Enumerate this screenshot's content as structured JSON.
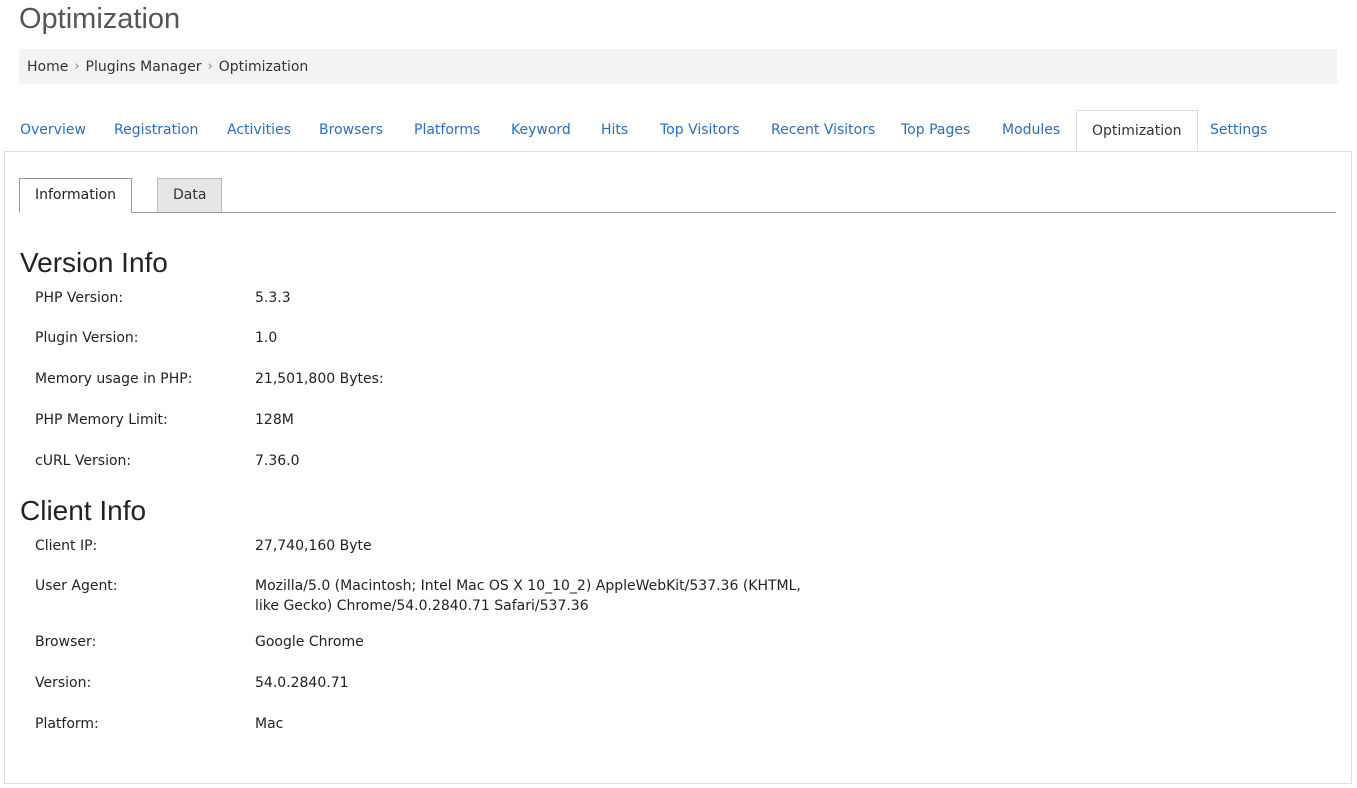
{
  "page": {
    "title": "Optimization"
  },
  "breadcrumb": {
    "items": [
      "Home",
      "Plugins Manager",
      "Optimization"
    ]
  },
  "main_tabs": [
    {
      "label": "Overview"
    },
    {
      "label": "Registration"
    },
    {
      "label": "Activities"
    },
    {
      "label": "Browsers"
    },
    {
      "label": "Platforms"
    },
    {
      "label": "Keyword"
    },
    {
      "label": "Hits"
    },
    {
      "label": "Top Visitors"
    },
    {
      "label": "Recent Visitors"
    },
    {
      "label": "Top Pages"
    },
    {
      "label": "Modules"
    },
    {
      "label": "Optimization",
      "active": true
    },
    {
      "label": "Settings"
    }
  ],
  "sub_tabs": [
    {
      "label": "Information",
      "active": true
    },
    {
      "label": "Data"
    }
  ],
  "version_info": {
    "heading": "Version Info",
    "rows": [
      {
        "label": "PHP Version:",
        "value": "5.3.3"
      },
      {
        "label": "Plugin Version:",
        "value": "1.0"
      },
      {
        "label": "Memory usage in PHP:",
        "value": "21,501,800 Bytes:"
      },
      {
        "label": "PHP Memory Limit:",
        "value": "128M"
      },
      {
        "label": "cURL Version:",
        "value": "7.36.0"
      }
    ]
  },
  "client_info": {
    "heading": "Client Info",
    "rows": [
      {
        "label": "Client IP:",
        "value": "27,740,160 Byte"
      },
      {
        "label": "User Agent:",
        "value": "Mozilla/5.0 (Macintosh; Intel Mac OS X 10_10_2) AppleWebKit/537.36 (KHTML, like Gecko) Chrome/54.0.2840.71 Safari/537.36"
      },
      {
        "label": "Browser:",
        "value": "Google Chrome"
      },
      {
        "label": "Version:",
        "value": "54.0.2840.71"
      },
      {
        "label": "Platform:",
        "value": "Mac"
      }
    ]
  },
  "colors": {
    "link": "#2a6ebb",
    "breadcrumb_bg": "#f3f3f3",
    "inactive_subtab_bg": "#e6e6e6"
  }
}
